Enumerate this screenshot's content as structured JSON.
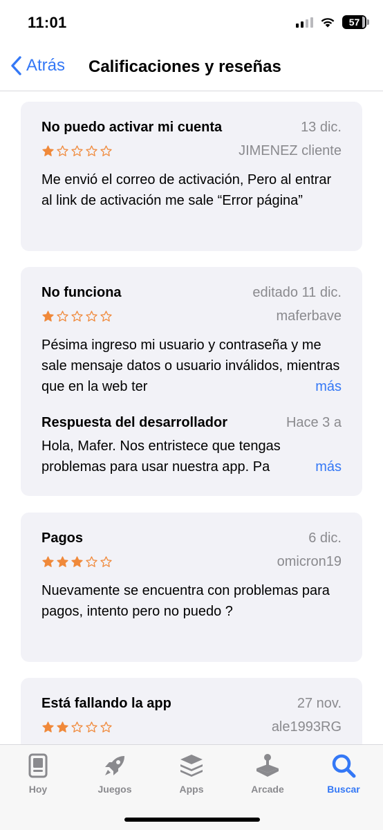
{
  "status": {
    "time": "11:01",
    "battery": "57"
  },
  "nav": {
    "back_label": "Atrás",
    "title": "Calificaciones y reseñas"
  },
  "colors": {
    "accent": "#3478f6",
    "star": "#f0893a",
    "card_bg": "#f2f2f7",
    "secondary_text": "#8a8a8e"
  },
  "reviews": [
    {
      "title": "No puedo activar mi cuenta",
      "date": "13 dic.",
      "author": "JIMENEZ cliente",
      "rating": 1,
      "body": "Me envió el correo de activación, Pero al entrar al link de activación me sale “Error página”"
    },
    {
      "title": "No funciona",
      "date": "editado 11 dic.",
      "author": "maferbave",
      "rating": 1,
      "body": "Pésima ingreso mi usuario y contraseña y me sale mensaje datos o usuario inválidos, mientras que en la web ter",
      "more_label": "más",
      "developer_response": {
        "title": "Respuesta del desarrollador",
        "date": "Hace 3 a",
        "body": "Hola, Mafer. Nos entristece que tengas problemas para usar nuestra app. Pa",
        "more_label": "más"
      }
    },
    {
      "title": "Pagos",
      "date": "6 dic.",
      "author": "omicron19",
      "rating": 3,
      "body": "Nuevamente se encuentra con problemas para pagos, intento pero no puedo ?"
    },
    {
      "title": "Está fallando la app",
      "date": "27 nov.",
      "author": "ale1993RG",
      "rating": 2,
      "body": ""
    }
  ],
  "tabs": [
    {
      "label": "Hoy",
      "icon": "today-icon",
      "active": false
    },
    {
      "label": "Juegos",
      "icon": "rocket-icon",
      "active": false
    },
    {
      "label": "Apps",
      "icon": "apps-stack-icon",
      "active": false
    },
    {
      "label": "Arcade",
      "icon": "joystick-icon",
      "active": false
    },
    {
      "label": "Buscar",
      "icon": "search-icon",
      "active": true
    }
  ]
}
